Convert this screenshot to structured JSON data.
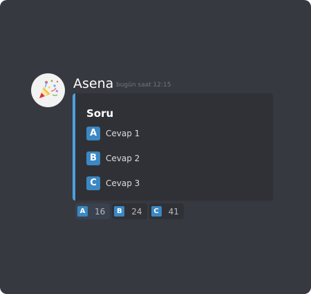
{
  "message": {
    "author": "Asena",
    "timestamp": "bugün saat 12:15",
    "avatar_icon": "party-popper-icon"
  },
  "embed": {
    "accent_color": "#4f9ede",
    "title": "Soru",
    "options": [
      {
        "letter": "A",
        "label": "Cevap 1"
      },
      {
        "letter": "B",
        "label": "Cevap 2"
      },
      {
        "letter": "C",
        "label": "Cevap 3"
      }
    ]
  },
  "reactions": [
    {
      "letter": "A",
      "count": "16"
    },
    {
      "letter": "B",
      "count": "24"
    },
    {
      "letter": "C",
      "count": "41"
    }
  ],
  "colors": {
    "background": "#36393f",
    "embed_background": "#2f3136",
    "letter_badge": "#3b88c3"
  }
}
